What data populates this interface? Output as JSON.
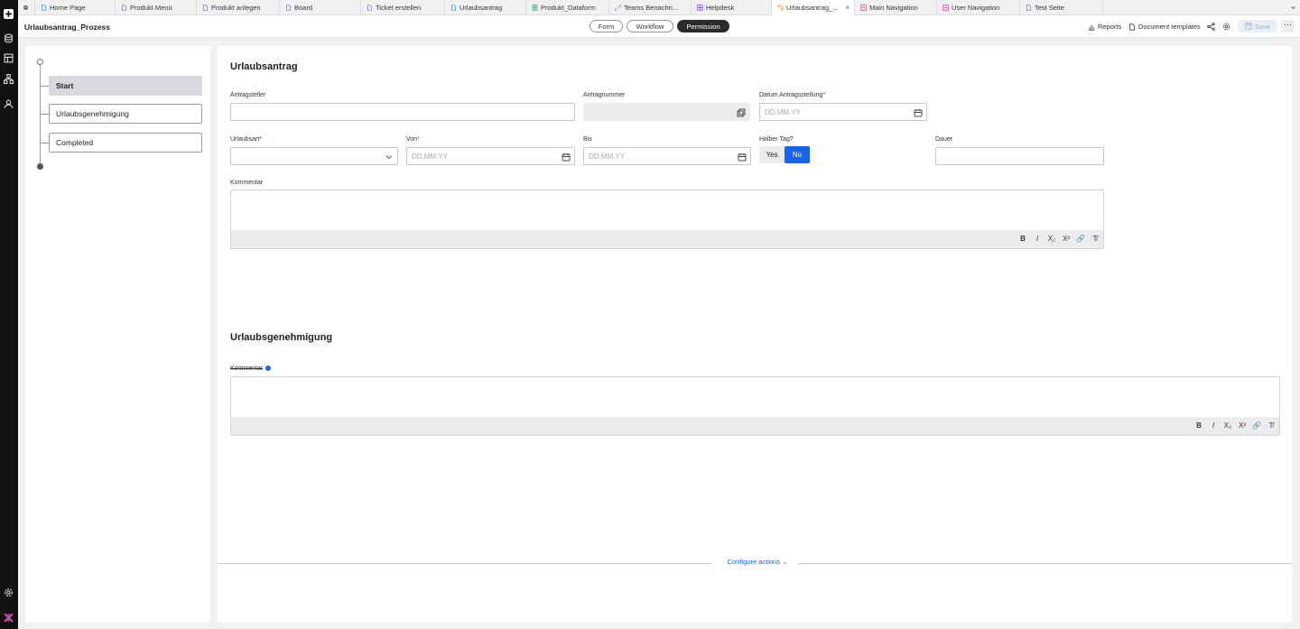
{
  "tabs": [
    {
      "label": "Home Page",
      "icon": "page-icon",
      "color": "#3b82f6"
    },
    {
      "label": "Produkt Menü",
      "icon": "page-icon",
      "color": "#3b82f6"
    },
    {
      "label": "Produkt anlegen",
      "icon": "page-icon",
      "color": "#3b82f6"
    },
    {
      "label": "Board",
      "icon": "page-icon",
      "color": "#3b82f6"
    },
    {
      "label": "Ticket erstellen",
      "icon": "page-icon",
      "color": "#3b82f6"
    },
    {
      "label": "Urlaubsantrag",
      "icon": "page-icon",
      "color": "#3b82f6"
    },
    {
      "label": "Produkt_Dataform",
      "icon": "dataform-icon",
      "color": "#22a35a"
    },
    {
      "label": "Teams Benachri...",
      "icon": "link-icon",
      "color": "#6b7280"
    },
    {
      "label": "Helpdesk",
      "icon": "board-icon",
      "color": "#7c3aed"
    },
    {
      "label": "Urlaubsantrag_...",
      "icon": "process-icon",
      "color": "#f59e0b"
    },
    {
      "label": "Main Navigation",
      "icon": "navigation-icon",
      "color": "#db2777"
    },
    {
      "label": "User Navigation",
      "icon": "navigation-icon",
      "color": "#db2777"
    },
    {
      "label": "Test Seite",
      "icon": "page-icon",
      "color": "#3b82f6"
    }
  ],
  "header": {
    "title": "Urlaubsantrag_Prozess",
    "modes": [
      "Form",
      "Workflow",
      "Permission"
    ],
    "selected_mode": "Permission",
    "reports": "Reports",
    "document_templates": "Document templates",
    "save": "Save",
    "more": "···"
  },
  "workflow": {
    "steps": [
      "Start",
      "Urlaubsgenehmigung",
      "Completed"
    ],
    "selected": "Start"
  },
  "form": {
    "section1": {
      "title": "Urlaubsantrag",
      "antragsteller": {
        "label": "Antragsteller",
        "value": ""
      },
      "antragnummer": {
        "label": "Antragnummer",
        "value": ""
      },
      "datum": {
        "label": "Datum Antragsstellung",
        "required": "*",
        "placeholder": "DD.MM.YY"
      },
      "urlaubsart": {
        "label": "Urlaubsart",
        "required": "*",
        "value": ""
      },
      "von": {
        "label": "Von",
        "required": "*",
        "placeholder": "DD.MM.YY"
      },
      "bis": {
        "label": "Bis",
        "placeholder": "DD.MM.YY"
      },
      "halber_tag": {
        "label": "Halber Tag?",
        "yes": "Yes",
        "no": "No",
        "selected": "No"
      },
      "dauer": {
        "label": "Dauer",
        "value": ""
      },
      "kommentar": {
        "label": "Kommentar"
      }
    },
    "section2": {
      "title": "Urlaubsgenehmigung",
      "kommentar": {
        "label": "Kommentar"
      }
    },
    "toolbar": [
      "B",
      "I",
      "X₂",
      "X²",
      "🔗",
      "T̸"
    ]
  },
  "footer": {
    "configure_actions": "Configure actions"
  },
  "colors": {
    "accent": "#1664f0",
    "selected_mode_bg": "#2a2a2a"
  }
}
